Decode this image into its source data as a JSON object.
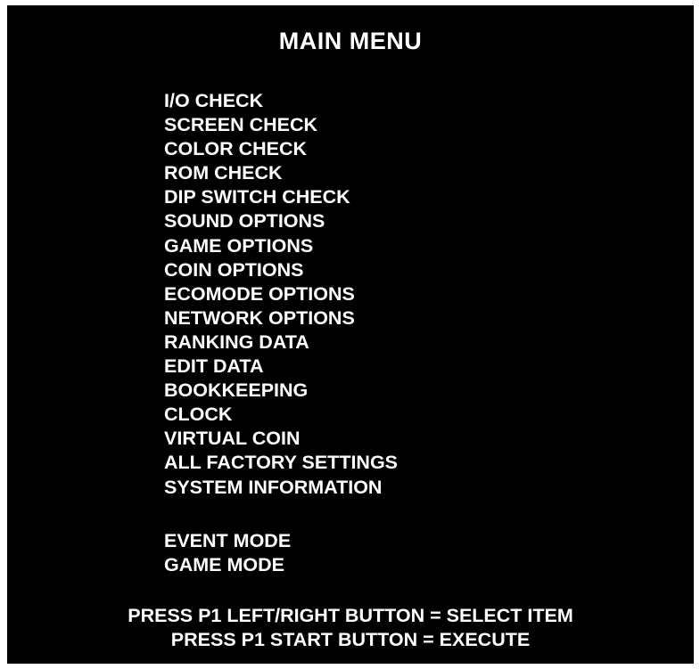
{
  "title": "MAIN MENU",
  "menu_items": [
    "I/O CHECK",
    "SCREEN CHECK",
    "COLOR CHECK",
    "ROM CHECK",
    "DIP SWITCH CHECK",
    "SOUND OPTIONS",
    "GAME OPTIONS",
    "COIN OPTIONS",
    "ECOMODE OPTIONS",
    "NETWORK OPTIONS",
    "RANKING DATA",
    "EDIT DATA",
    "BOOKKEEPING",
    "CLOCK",
    "VIRTUAL COIN",
    "ALL FACTORY SETTINGS",
    "SYSTEM INFORMATION"
  ],
  "mode_items": [
    "EVENT MODE",
    "GAME MODE"
  ],
  "footer": {
    "line1": "PRESS P1 LEFT/RIGHT BUTTON = SELECT ITEM",
    "line2": "PRESS P1 START BUTTON = EXECUTE"
  },
  "colors": {
    "background": "#000000",
    "text": "#ffffff"
  }
}
